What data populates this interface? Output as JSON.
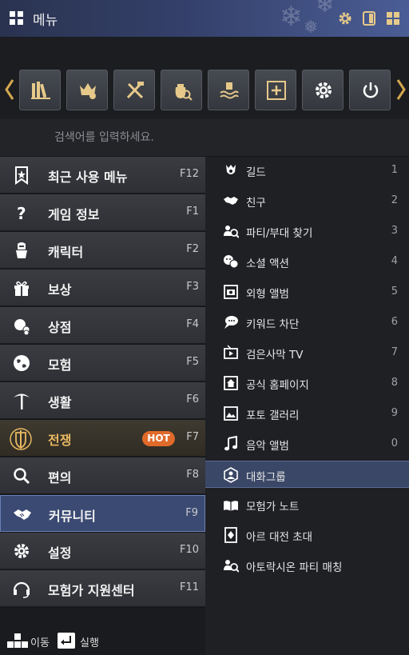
{
  "window": {
    "title": "메뉴"
  },
  "search": {
    "placeholder": "검색어를 입력하세요."
  },
  "toolbar": {
    "buttons": [
      "library-icon",
      "helmet-bell-icon",
      "tools-icon",
      "bag-search-icon",
      "hand-water-icon",
      "add-box-icon",
      "gear-icon",
      "power-icon"
    ]
  },
  "menu": {
    "items": [
      {
        "label": "최근 사용 메뉴",
        "key": "F12",
        "icon": "bookmark-star-icon"
      },
      {
        "label": "게임 정보",
        "key": "F1",
        "icon": "question-icon"
      },
      {
        "label": "캐릭터",
        "key": "F2",
        "icon": "knight-icon"
      },
      {
        "label": "보상",
        "key": "F3",
        "icon": "gift-icon"
      },
      {
        "label": "상점",
        "key": "F4",
        "icon": "shop-icon"
      },
      {
        "label": "모험",
        "key": "F5",
        "icon": "globe-icon"
      },
      {
        "label": "생활",
        "key": "F6",
        "icon": "pickaxe-icon"
      },
      {
        "label": "전쟁",
        "key": "F7",
        "icon": "shield-sword-icon",
        "badge": "HOT"
      },
      {
        "label": "편의",
        "key": "F8",
        "icon": "magnifier-icon"
      },
      {
        "label": "커뮤니티",
        "key": "F9",
        "icon": "handshake-icon"
      },
      {
        "label": "설정",
        "key": "F10",
        "icon": "gear-icon"
      },
      {
        "label": "모험가 지원센터",
        "key": "F11",
        "icon": "headset-icon"
      }
    ]
  },
  "submenu": {
    "items": [
      {
        "label": "길드",
        "key": "1",
        "icon": "guild-icon"
      },
      {
        "label": "친구",
        "key": "2",
        "icon": "handshake-icon"
      },
      {
        "label": "파티/부대 찾기",
        "key": "3",
        "icon": "party-search-icon"
      },
      {
        "label": "소셜 액션",
        "key": "4",
        "icon": "emote-icon"
      },
      {
        "label": "외형 앨범",
        "key": "5",
        "icon": "camera-frame-icon"
      },
      {
        "label": "키워드 차단",
        "key": "6",
        "icon": "speech-bubble-icon"
      },
      {
        "label": "검은사막 TV",
        "key": "7",
        "icon": "tv-icon"
      },
      {
        "label": "공식 홈페이지",
        "key": "8",
        "icon": "home-icon"
      },
      {
        "label": "포토 갤러리",
        "key": "9",
        "icon": "photo-icon"
      },
      {
        "label": "음악 앨범",
        "key": "0",
        "icon": "music-note-icon"
      },
      {
        "label": "대화그룹",
        "key": "",
        "icon": "chat-group-icon"
      },
      {
        "label": "모험가 노트",
        "key": "",
        "icon": "book-icon"
      },
      {
        "label": "아르 대전 초대",
        "key": "",
        "icon": "arena-icon"
      },
      {
        "label": "아토락시온 파티 매칭",
        "key": "",
        "icon": "party-search-icon"
      }
    ]
  },
  "hints": {
    "move": "이동",
    "execute": "실행"
  },
  "colors": {
    "accent": "#3a4a72",
    "hot": "#e06a2a",
    "war_label": "#e8b861",
    "toolbar_icon": "#e6c98a"
  }
}
